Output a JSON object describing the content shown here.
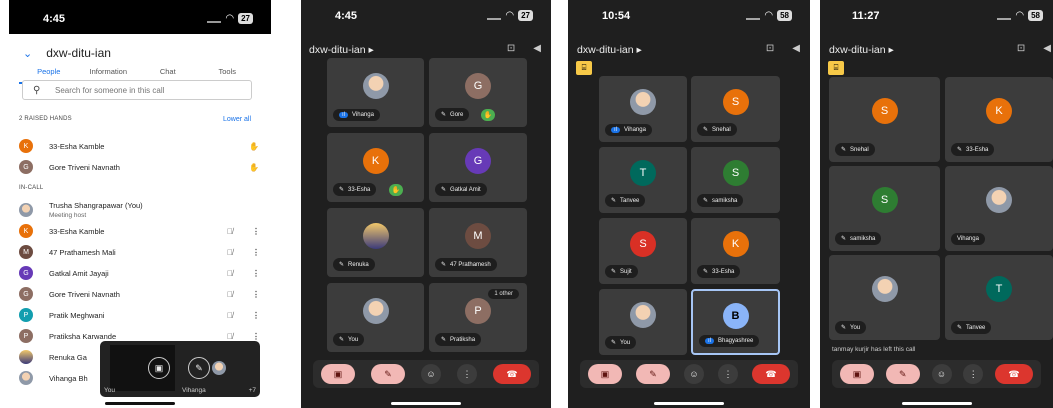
{
  "phone1": {
    "time": "4:45",
    "battery": "27",
    "title": "dxw-ditu-ian",
    "tabs": [
      "People",
      "Information",
      "Chat",
      "Tools"
    ],
    "search_placeholder": "Search for someone in this call",
    "raised_label": "2 RAISED HANDS",
    "lower_all": "Lower all",
    "raised": [
      {
        "initial": "K",
        "name": "33-Esha Kamble",
        "color": "#e8710a"
      },
      {
        "initial": "G",
        "name": "Gore Triveni Navnath",
        "color": "#8d6e63"
      }
    ],
    "incall_label": "IN-CALL",
    "host": {
      "name": "Trusha Shangrapawar (You)",
      "sub": "Meeting host"
    },
    "people": [
      {
        "initial": "K",
        "name": "33-Esha Kamble",
        "color": "#e8710a"
      },
      {
        "initial": "M",
        "name": "47 Prathamesh Mali",
        "color": "#6d4c41"
      },
      {
        "initial": "G",
        "name": "Gatkal Amit Jayaji",
        "color": "#673ab7"
      },
      {
        "initial": "G",
        "name": "Gore Triveni Navnath",
        "color": "#8d6e63"
      },
      {
        "initial": "P",
        "name": "Pratik Meghwani",
        "color": "#129eaf"
      },
      {
        "initial": "P",
        "name": "Pratiksha Karwande",
        "color": "#8d6e63"
      },
      {
        "initial": "",
        "name": "Renuka Ga",
        "color": ""
      },
      {
        "initial": "",
        "name": "Vihanga Bh",
        "color": ""
      }
    ],
    "pip": {
      "you": "You",
      "vihanga": "Vihanga",
      "more": "+7"
    }
  },
  "phone2": {
    "time": "4:45",
    "battery": "27",
    "title": "dxw-ditu-ian ▸",
    "tiles": [
      {
        "initial": "",
        "name": "Vihanga",
        "color": "",
        "speaking": true
      },
      {
        "initial": "G",
        "name": "Gore",
        "color": "#8d6e63",
        "hand": true
      },
      {
        "initial": "K",
        "name": "33-Esha",
        "color": "#e8710a",
        "hand": true
      },
      {
        "initial": "G",
        "name": "Gatkal Amit",
        "color": "#673ab7"
      },
      {
        "initial": "",
        "name": "Renuka",
        "color": ""
      },
      {
        "initial": "M",
        "name": "47 Prathamesh",
        "color": "#6d4c41"
      },
      {
        "initial": "",
        "name": "You",
        "color": ""
      },
      {
        "initial": "P",
        "name": "Pratiksha",
        "color": "#8d6e63"
      }
    ],
    "other_badge": "1 other"
  },
  "phone3": {
    "time": "10:54",
    "battery": "58",
    "title": "dxw-ditu-ian ▸",
    "tiles": [
      {
        "initial": "",
        "name": "Vihanga",
        "color": "",
        "speaking": true
      },
      {
        "initial": "S",
        "name": "Snehal",
        "color": "#e8710a"
      },
      {
        "initial": "T",
        "name": "Tanvee",
        "color": "#00695c"
      },
      {
        "initial": "S",
        "name": "samiksha",
        "color": "#2e7d32"
      },
      {
        "initial": "S",
        "name": "Sujit",
        "color": "#d93025"
      },
      {
        "initial": "K",
        "name": "33-Esha",
        "color": "#e8710a"
      },
      {
        "initial": "",
        "name": "You",
        "color": ""
      },
      {
        "initial": "B",
        "name": "Bhagyashree",
        "color": "#8ab4f8",
        "speaking": true,
        "selected": true
      }
    ]
  },
  "phone4": {
    "time": "11:27",
    "battery": "58",
    "title": "dxw-ditu-ian ▸",
    "tiles": [
      {
        "initial": "S",
        "name": "Snehal",
        "color": "#e8710a"
      },
      {
        "initial": "K",
        "name": "33-Esha",
        "color": "#e8710a"
      },
      {
        "initial": "S",
        "name": "samiksha",
        "color": "#2e7d32"
      },
      {
        "initial": "",
        "name": "Vihanga",
        "color": ""
      },
      {
        "initial": "",
        "name": "You",
        "color": ""
      },
      {
        "initial": "T",
        "name": "Tanvee",
        "color": "#00695c"
      }
    ],
    "left_msg": "tanmay kurjir has left this call"
  }
}
